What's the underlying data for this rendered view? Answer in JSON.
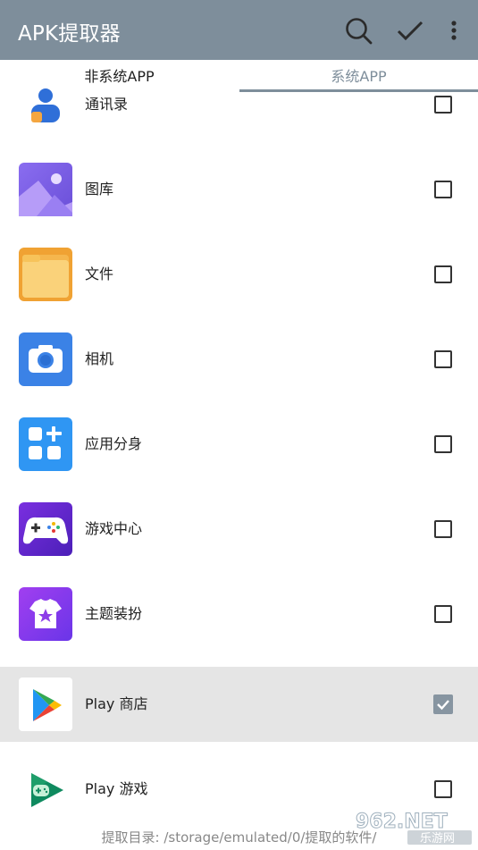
{
  "appbar": {
    "title": "APK提取器",
    "background": "#7e8e9b",
    "actions": [
      "search-icon",
      "check-icon",
      "more-vert-icon"
    ]
  },
  "tabs": [
    {
      "label": "非系统APP",
      "active": false
    },
    {
      "label": "系统APP",
      "active": true
    }
  ],
  "apps": [
    {
      "name": "通讯录",
      "icon": "contacts-icon",
      "checked": false
    },
    {
      "name": "图库",
      "icon": "gallery-icon",
      "checked": false
    },
    {
      "name": "文件",
      "icon": "files-icon",
      "checked": false
    },
    {
      "name": "相机",
      "icon": "camera-icon",
      "checked": false
    },
    {
      "name": "应用分身",
      "icon": "app-clone-icon",
      "checked": false
    },
    {
      "name": "游戏中心",
      "icon": "game-center-icon",
      "checked": false
    },
    {
      "name": "主题装扮",
      "icon": "themes-icon",
      "checked": false
    },
    {
      "name": "Play 商店",
      "icon": "play-store-icon",
      "checked": true
    },
    {
      "name": "Play 游戏",
      "icon": "play-games-icon",
      "checked": false
    }
  ],
  "footer": {
    "extract_dir": "提取目录: /storage/emulated/0/提取的软件/"
  },
  "watermark": {
    "top_text": "962.NET",
    "bottom_text": "乐游网"
  }
}
